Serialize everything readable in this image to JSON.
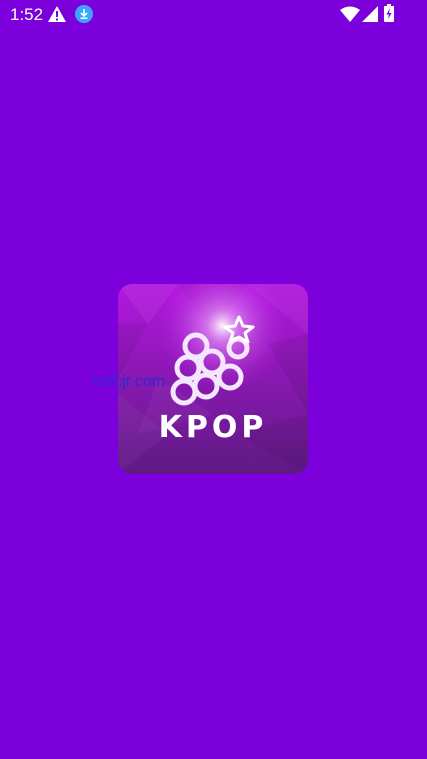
{
  "status_bar": {
    "time": "1:52",
    "left_icons": [
      "warning-icon",
      "download-icon"
    ],
    "right_icons": [
      "wifi-icon",
      "signal-icon",
      "battery-charging-icon"
    ]
  },
  "splash": {
    "logo_text": "KPOP",
    "watermark": "hnfcjr.com"
  },
  "colors": {
    "background": "#7b00dc",
    "logo_gradient_top": "#b317e0",
    "logo_gradient_bottom": "#5e1a82"
  }
}
